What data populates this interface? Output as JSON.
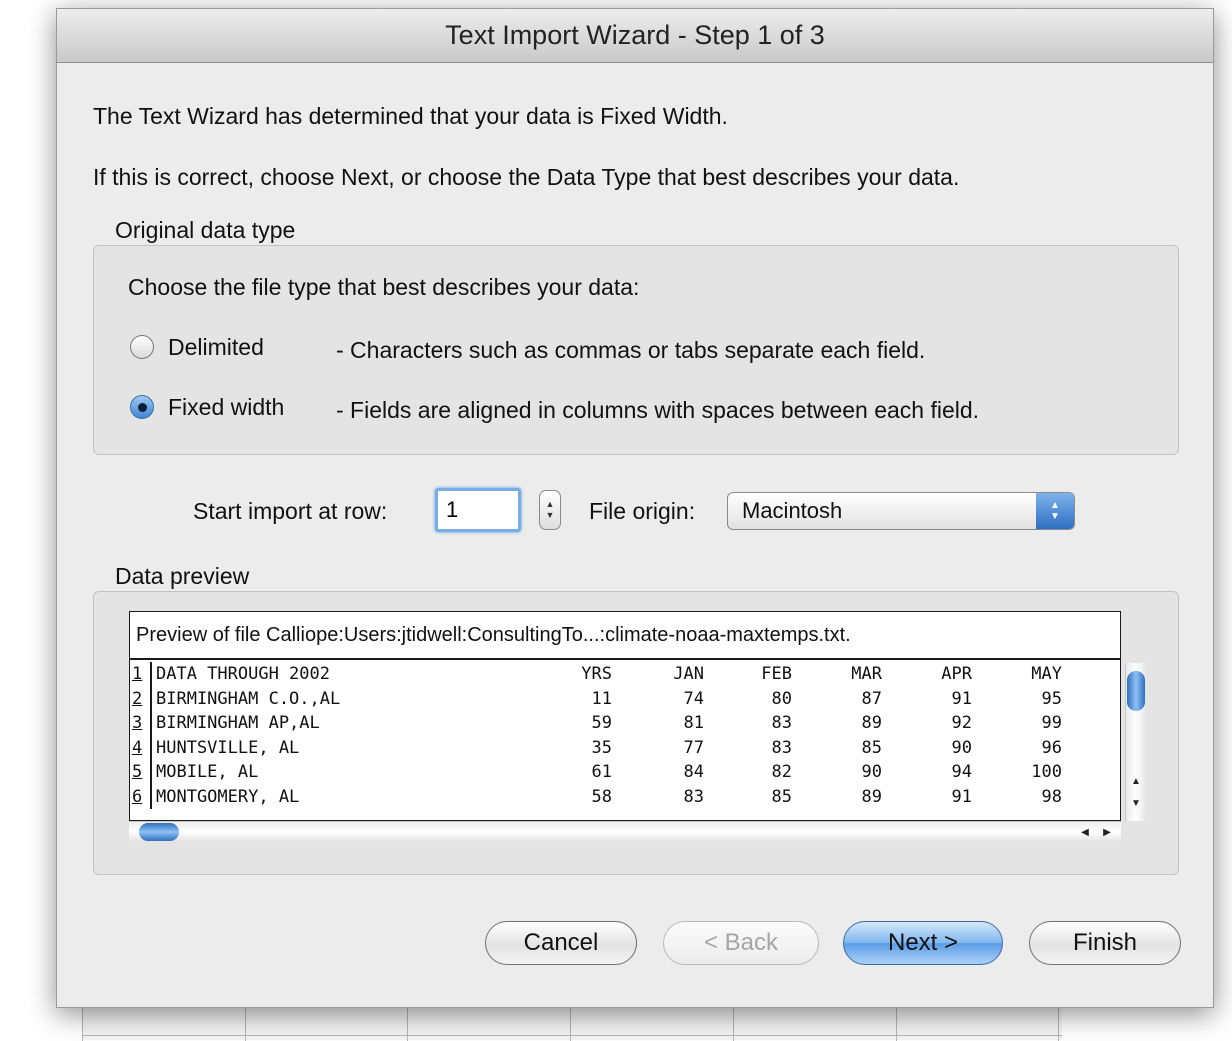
{
  "window": {
    "title": "Text Import Wizard - Step 1 of 3"
  },
  "intro": {
    "line1": "The Text Wizard has determined that your data is Fixed Width.",
    "line2": "If this is correct, choose Next, or choose the Data Type that best describes your data."
  },
  "original_data_type": {
    "label": "Original data type",
    "prompt": "Choose the file type that best describes your data:",
    "options": [
      {
        "label": "Delimited",
        "description": "- Characters such as commas or tabs separate each field.",
        "selected": false
      },
      {
        "label": "Fixed width",
        "description": "- Fields are aligned in columns with spaces between each field.",
        "selected": true
      }
    ]
  },
  "import_settings": {
    "start_row_label": "Start import at row:",
    "start_row_value": "1",
    "file_origin_label": "File origin:",
    "file_origin_value": "Macintosh"
  },
  "preview": {
    "label": "Data preview",
    "header": "Preview of file Calliope:Users:jtidwell:ConsultingTo...:climate-noaa-maxtemps.txt.",
    "rows": [
      {
        "n": "1",
        "name": "DATA THROUGH 2002",
        "cols": [
          "YRS",
          "JAN",
          "FEB",
          "MAR",
          "APR",
          "MAY"
        ]
      },
      {
        "n": "2",
        "name": "BIRMINGHAM C.O.,AL",
        "cols": [
          "11",
          "74",
          "80",
          "87",
          "91",
          "95"
        ]
      },
      {
        "n": "3",
        "name": "BIRMINGHAM AP,AL",
        "cols": [
          "59",
          "81",
          "83",
          "89",
          "92",
          "99"
        ]
      },
      {
        "n": "4",
        "name": "HUNTSVILLE, AL",
        "cols": [
          "35",
          "77",
          "83",
          "85",
          "90",
          "96"
        ]
      },
      {
        "n": "5",
        "name": "MOBILE, AL",
        "cols": [
          "61",
          "84",
          "82",
          "90",
          "94",
          "100"
        ]
      },
      {
        "n": "6",
        "name": "MONTGOMERY, AL",
        "cols": [
          "58",
          "83",
          "85",
          "89",
          "91",
          "98"
        ]
      }
    ]
  },
  "buttons": {
    "cancel": "Cancel",
    "back": "< Back",
    "next": "Next >",
    "finish": "Finish"
  },
  "colors": {
    "accent": "#5b9de6",
    "dialog_bg": "#ececec"
  }
}
